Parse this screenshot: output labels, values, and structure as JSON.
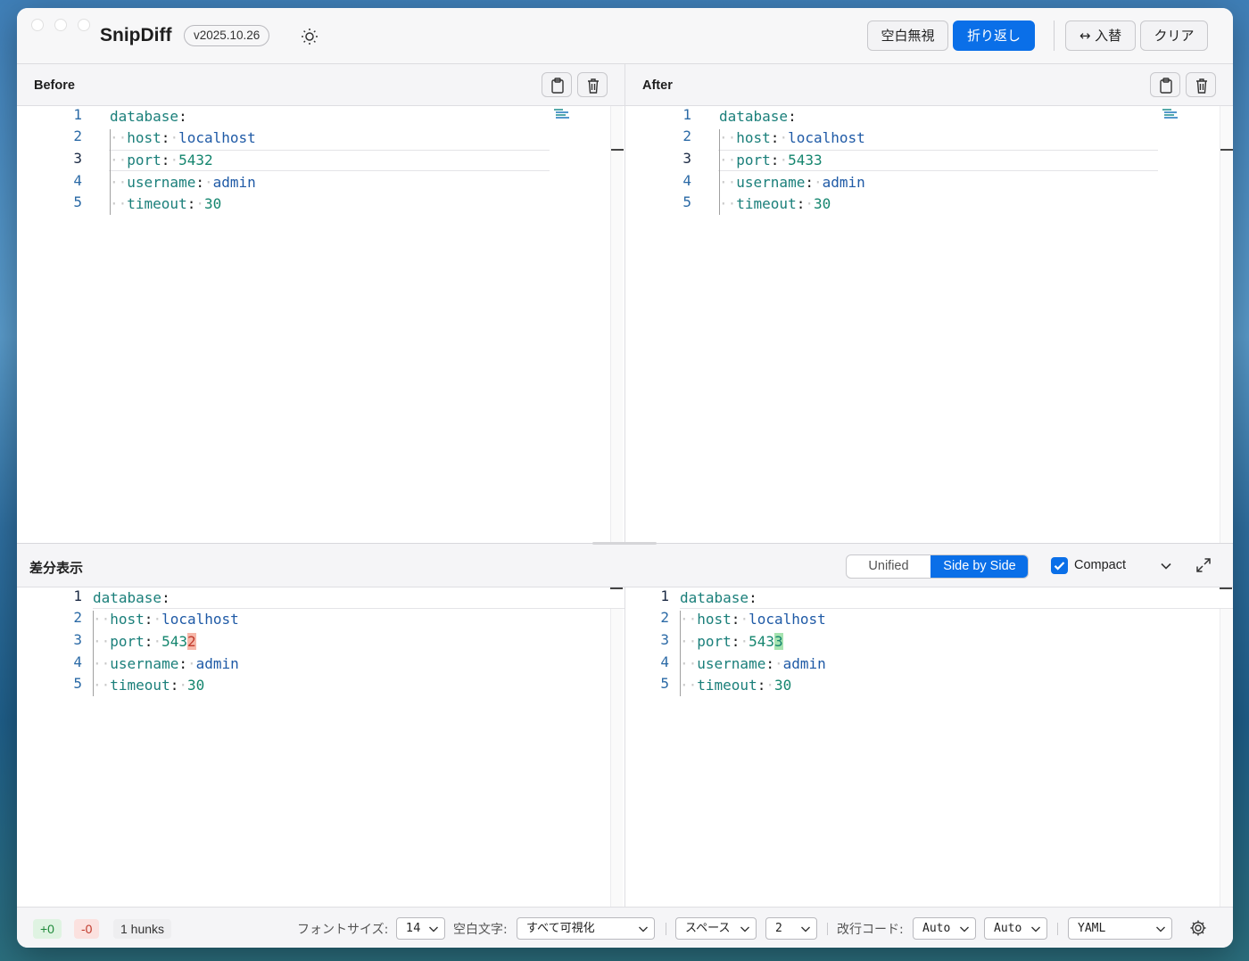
{
  "app": {
    "title": "SnipDiff",
    "version": "v2025.10.26"
  },
  "toolbar": {
    "ignore_whitespace": "空白無視",
    "wrap": "折り返し",
    "swap": "↔ 入替",
    "clear": "クリア"
  },
  "before": {
    "title": "Before",
    "lines": [
      {
        "no": "1",
        "key": "database",
        "value": ""
      },
      {
        "no": "2",
        "key": "host",
        "value": "localhost"
      },
      {
        "no": "3",
        "key": "port",
        "value": "5432"
      },
      {
        "no": "4",
        "key": "username",
        "value": "admin"
      },
      {
        "no": "5",
        "key": "timeout",
        "value": "30"
      }
    ]
  },
  "after": {
    "title": "After",
    "lines": [
      {
        "no": "1",
        "key": "database",
        "value": ""
      },
      {
        "no": "2",
        "key": "host",
        "value": "localhost"
      },
      {
        "no": "3",
        "key": "port",
        "value": "5433"
      },
      {
        "no": "4",
        "key": "username",
        "value": "admin"
      },
      {
        "no": "5",
        "key": "timeout",
        "value": "30"
      }
    ]
  },
  "diff": {
    "title": "差分表示",
    "mode_unified": "Unified",
    "mode_side_by_side": "Side by Side",
    "compact_label": "Compact",
    "compact_checked": true,
    "left_port_prefix": "543",
    "left_port_changed": "2",
    "right_port_prefix": "543",
    "right_port_changed": "3"
  },
  "footer": {
    "added": "+0",
    "removed": "-0",
    "hunks": "1 hunks",
    "font_size_label": "フォントサイズ:",
    "font_size": "14",
    "whitespace_label": "空白文字:",
    "whitespace": "すべて可視化",
    "indent_type": "スペース",
    "indent_size": "2",
    "eol_label": "改行コード:",
    "eol_left": "Auto",
    "eol_right": "Auto",
    "language": "YAML"
  },
  "colors": {
    "accent": "#0a6fe8",
    "added_bg": "#a6e3b0",
    "removed_bg": "#f6b7a9"
  }
}
